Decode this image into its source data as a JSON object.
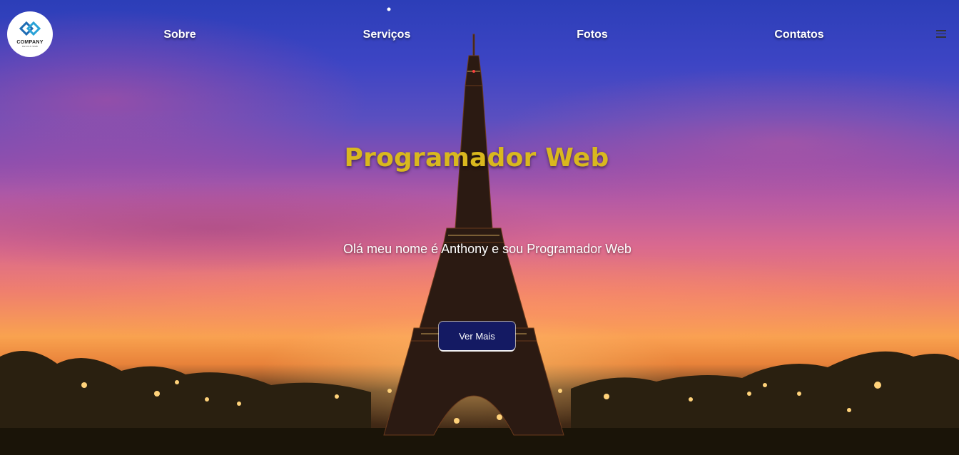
{
  "logo": {
    "name": "COMPANY",
    "tagline": "DESIGN WEB",
    "icon": "diamond-logo-icon"
  },
  "nav": {
    "items": [
      {
        "label": "Sobre"
      },
      {
        "label": "Serviços"
      },
      {
        "label": "Fotos"
      },
      {
        "label": "Contatos"
      }
    ],
    "menu_icon": "hamburger-menu-icon"
  },
  "hero": {
    "title": "Programador Web",
    "subtitle": "Olá meu nome é Anthony e sou Programador Web",
    "cta_label": "Ver Mais",
    "background": "eiffel-tower-sunset-photo"
  },
  "colors": {
    "title": "#d9b81e",
    "button": "#141a63",
    "nav_text": "#ffffff"
  }
}
